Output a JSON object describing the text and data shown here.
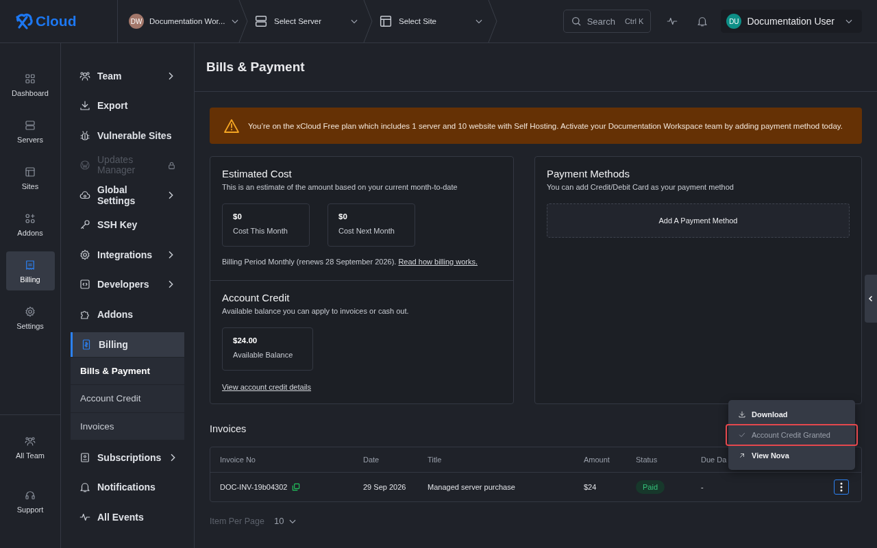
{
  "topbar": {
    "logo": "Cloud",
    "breadcrumbs": [
      {
        "kind": "avatar",
        "initials": "DW",
        "label": "Documentation Wor..."
      },
      {
        "kind": "server",
        "label": "Select Server"
      },
      {
        "kind": "site",
        "label": "Select Site"
      }
    ],
    "search": {
      "placeholder": "Search",
      "shortcut": "Ctrl K"
    },
    "user": {
      "initials": "DU",
      "name": "Documentation User"
    }
  },
  "rail": {
    "items": [
      {
        "label": "Dashboard",
        "selected": false
      },
      {
        "label": "Servers",
        "selected": false
      },
      {
        "label": "Sites",
        "selected": false
      },
      {
        "label": "Addons",
        "selected": false
      },
      {
        "label": "Billing",
        "selected": true
      },
      {
        "label": "Settings",
        "selected": false
      }
    ],
    "bottom_items": [
      {
        "label": "All Team"
      },
      {
        "label": "Support"
      }
    ]
  },
  "sidebar": {
    "items": [
      {
        "label": "Team",
        "has_submenu": true,
        "disabled": false
      },
      {
        "label": "Export",
        "has_submenu": false,
        "disabled": false
      },
      {
        "label": "Vulnerable Sites",
        "has_submenu": false,
        "disabled": false
      },
      {
        "label": "Updates Manager",
        "has_submenu": false,
        "disabled": true
      },
      {
        "label": "Global Settings",
        "has_submenu": true,
        "disabled": false
      },
      {
        "label": "SSH Key",
        "has_submenu": false,
        "disabled": false
      },
      {
        "label": "Integrations",
        "has_submenu": true,
        "disabled": false
      },
      {
        "label": "Developers",
        "has_submenu": true,
        "disabled": false
      },
      {
        "label": "Addons",
        "has_submenu": false,
        "disabled": false
      },
      {
        "label": "Billing",
        "expanded": true,
        "children": [
          {
            "label": "Bills & Payment",
            "selected": true
          },
          {
            "label": "Account Credit",
            "selected": false
          },
          {
            "label": "Invoices",
            "selected": false
          }
        ]
      },
      {
        "label": "Subscriptions",
        "has_submenu": true,
        "disabled": false
      },
      {
        "label": "Notifications",
        "has_submenu": false,
        "disabled": false
      },
      {
        "label": "All Events",
        "has_submenu": false,
        "disabled": false
      }
    ]
  },
  "page": {
    "title": "Bills & Payment",
    "alert": "You’re on the xCloud Free plan which includes 1 server and 10 website with Self Hosting. Activate your Documentation Workspace team by adding payment method today.",
    "estimated_cost": {
      "title": "Estimated Cost",
      "subtitle": "This is an estimate of the amount based on your current month-to-date",
      "stats": [
        {
          "value": "$0",
          "label": "Cost This Month"
        },
        {
          "value": "$0",
          "label": "Cost Next Month"
        }
      ],
      "period": "Billing Period Monthly (renews 28 September 2026).",
      "link": "Read how billing works."
    },
    "account_credit": {
      "title": "Account Credit",
      "subtitle": "Available balance you can apply to invoices or cash out.",
      "stats": [
        {
          "value": "$24.00",
          "label": "Available Balance"
        }
      ],
      "link": "View account credit details"
    },
    "payment_methods": {
      "title": "Payment Methods",
      "subtitle": "You can add Credit/Debit Card as your payment method",
      "add_button": "Add A Payment Method"
    },
    "invoices": {
      "title": "Invoices",
      "columns": [
        "Invoice No",
        "Date",
        "Title",
        "Amount",
        "Status",
        "Due Da"
      ],
      "rows": [
        {
          "invoice_no": "DOC-INV-19b04302",
          "date": "29 Sep 2026",
          "title": "Managed server purchase",
          "amount": "$24",
          "status": "Paid",
          "due": "-"
        }
      ],
      "per_page_label": "Item Per Page",
      "per_page": "10"
    },
    "menu": [
      {
        "kind": "download",
        "label": "Download",
        "disabled": false,
        "highlighted": false
      },
      {
        "kind": "check",
        "label": "Account Credit Granted",
        "disabled": true,
        "highlighted": true
      },
      {
        "kind": "external",
        "label": "View Nova",
        "disabled": false,
        "highlighted": false
      }
    ]
  }
}
